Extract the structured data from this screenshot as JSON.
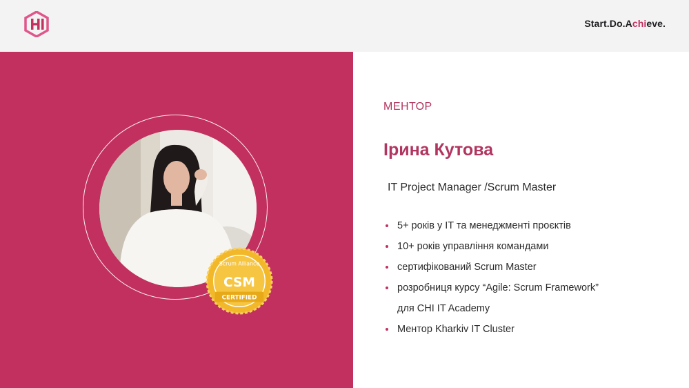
{
  "header": {
    "logo_text": "CHI",
    "tagline": {
      "part1": "Start.Do.A",
      "accent": "chi",
      "part2": "eve."
    }
  },
  "profile": {
    "role": "МЕНТОР",
    "name": "Ірина Кутова",
    "position": "IT Project Manager /Scrum Master",
    "facts": [
      {
        "lines": [
          "5+ років у IT та менеджменті проєктів"
        ]
      },
      {
        "lines": [
          "10+ років управління командами"
        ]
      },
      {
        "lines": [
          "сертифікований Scrum Master"
        ]
      },
      {
        "lines": [
          "розробниця курсу “Agile: Scrum Framework”",
          "для CHI IT Academy"
        ]
      },
      {
        "lines": [
          "Ментор Kharkiv IT Cluster"
        ]
      }
    ]
  },
  "badge": {
    "top_text": "Scrum Alliance",
    "main_text": "CSM",
    "bottom_text": "CERTIFIED"
  },
  "colors": {
    "brand": "#c2305f",
    "heading": "#b13560",
    "badge_gold": "#f2b829"
  }
}
